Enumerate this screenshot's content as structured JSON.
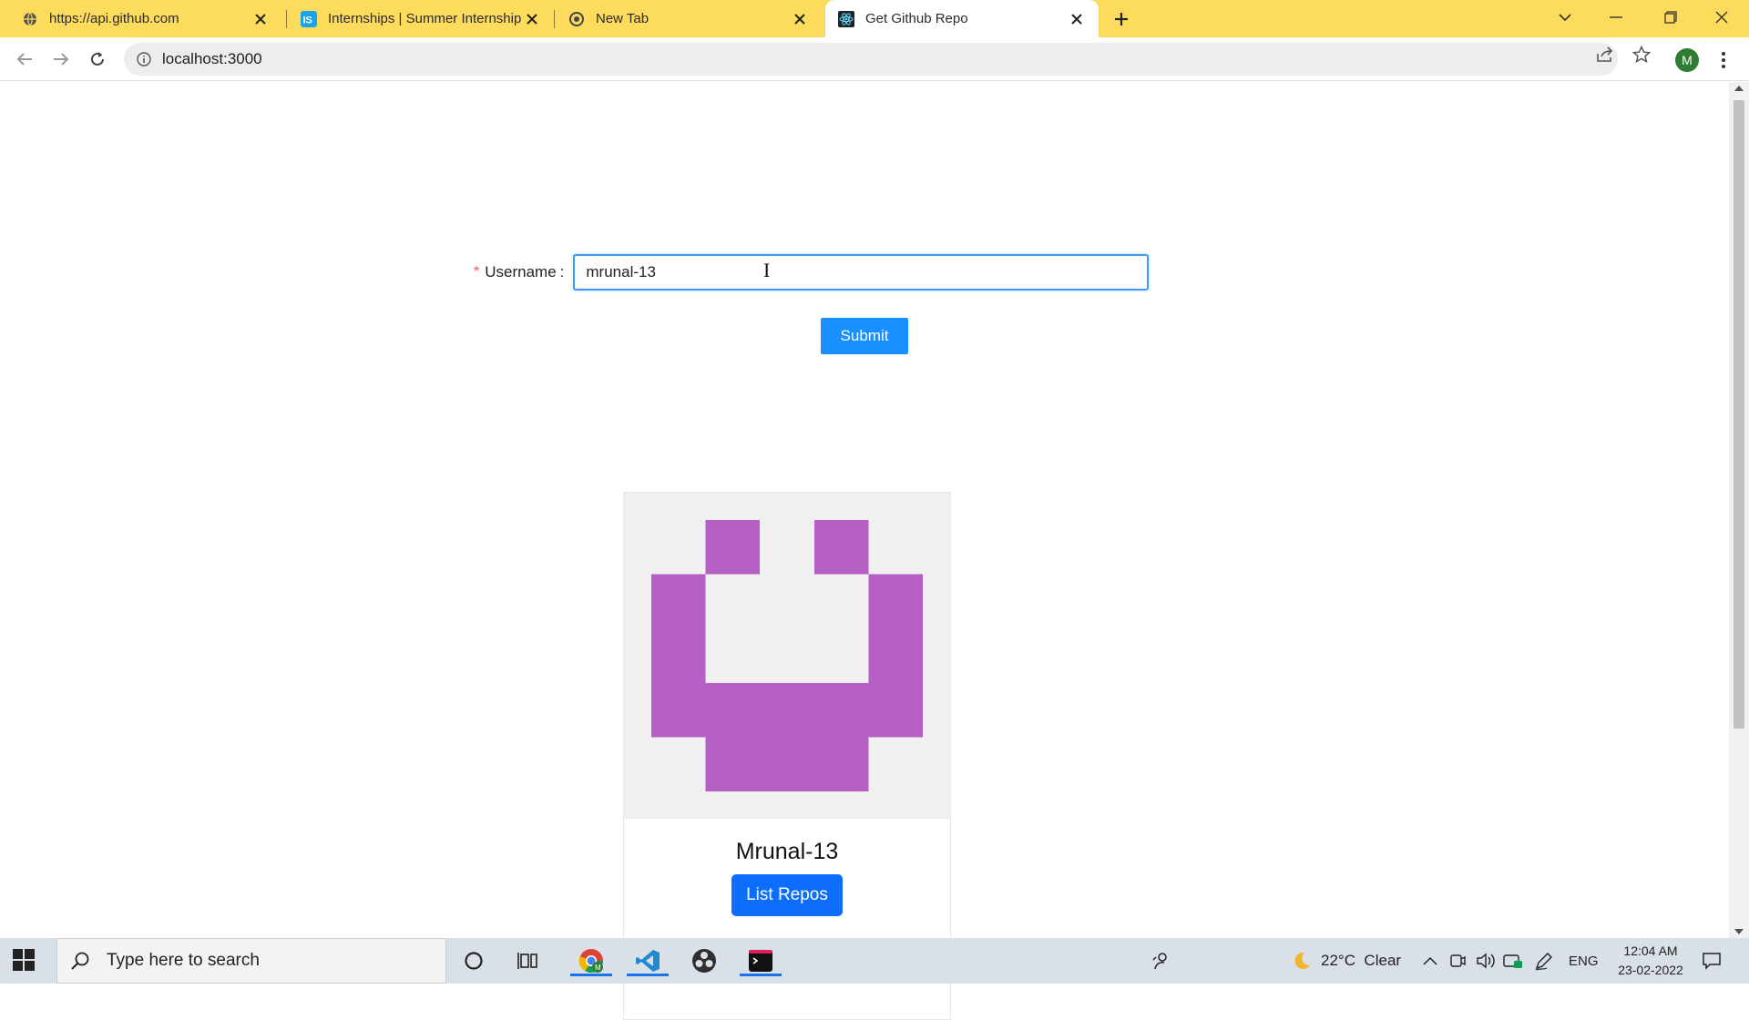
{
  "browser": {
    "tabs": [
      {
        "title": "https://api.github.com",
        "favicon": "globe-icon",
        "active": false
      },
      {
        "title": "Internships | Summer Internship",
        "favicon": "internshala-icon",
        "active": false
      },
      {
        "title": "New Tab",
        "favicon": "chrome-icon",
        "active": false
      },
      {
        "title": "Get Github Repo",
        "favicon": "react-icon",
        "active": true
      }
    ],
    "url": "localhost:3000",
    "profile_initial": "M"
  },
  "form": {
    "label": "Username",
    "required_mark": "*",
    "username_value": "mrunal-13",
    "submit_label": "Submit"
  },
  "card": {
    "name": "Mrunal-13",
    "button_label": "List Repos",
    "identicon_color": "#b55fc4"
  },
  "taskbar": {
    "search_placeholder": "Type here to search",
    "weather": "22°C  Clear",
    "language": "ENG",
    "time": "12:04 AM",
    "date": "23-02-2022"
  },
  "colors": {
    "tabstrip_bg": "#fddb5c",
    "primary_antd": "#1890ff",
    "primary_bootstrap": "#0d6efd"
  }
}
